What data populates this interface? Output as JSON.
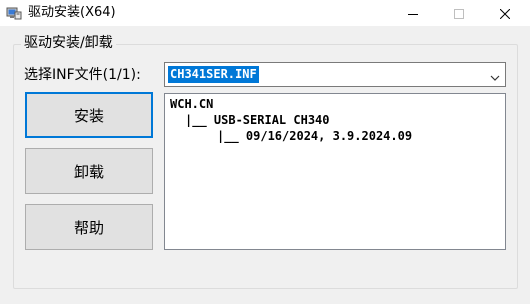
{
  "window": {
    "title": "驱动安装(X64)"
  },
  "group": {
    "label": "驱动安装/卸载"
  },
  "inf_select": {
    "label": "选择INF文件(1/1):",
    "selected": "CH341SER.INF"
  },
  "buttons": {
    "install": "安装",
    "uninstall": "卸载",
    "help": "帮助"
  },
  "driver_info": {
    "lines": [
      "WCH.CN",
      "|__ USB-SERIAL CH340",
      "|__ 09/16/2024, 3.9.2024.09"
    ]
  },
  "icons": {
    "app": "driver-setup-icon",
    "minimize": "minimize-icon",
    "maximize": "maximize-icon",
    "close": "close-icon",
    "dropdown": "chevron-down-icon"
  },
  "colors": {
    "selection": "#0078d7",
    "window_bg": "#f0f0f0"
  }
}
